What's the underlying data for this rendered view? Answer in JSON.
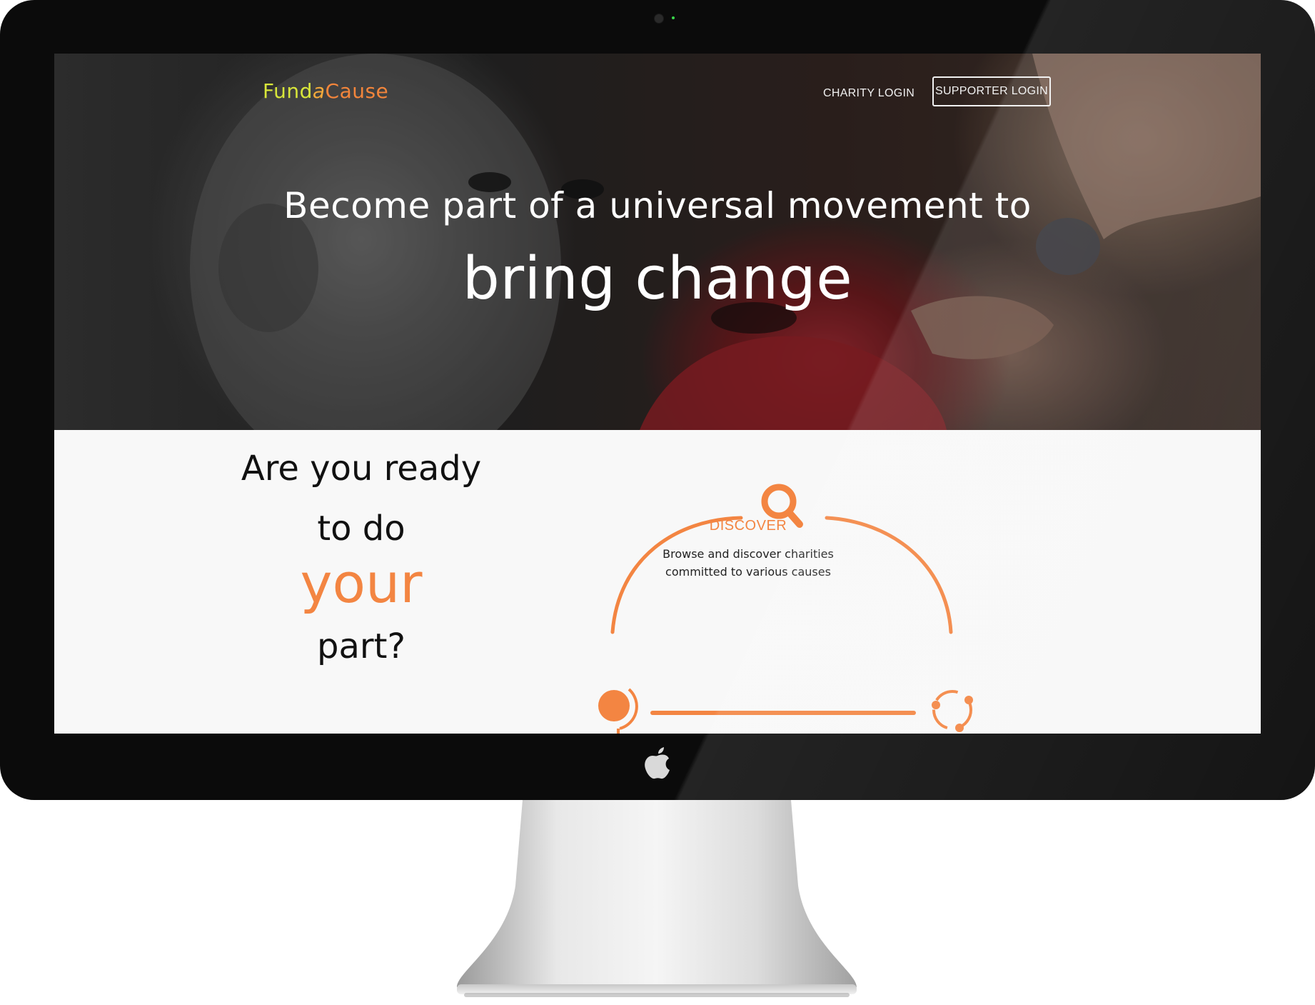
{
  "logo": {
    "part1": "Fund",
    "part2": "a",
    "part3": "Cause"
  },
  "nav": {
    "charity_login": "CHARITY LOGIN",
    "supporter_login": "SUPPORTER LOGIN"
  },
  "hero": {
    "line1": "Become part of a universal movement to",
    "line2": "bring change"
  },
  "ready": {
    "line1": "Are you ready",
    "line2": "to do",
    "line3": "your",
    "line4": "part?"
  },
  "process": {
    "discover_title": "DISCOVER",
    "discover_desc_line1": "Browse and discover charities",
    "discover_desc_line2": "committed to various causes"
  },
  "icons": [
    "search-icon",
    "globe-icon",
    "cycle-icon",
    "apple-logo-icon"
  ],
  "colors": {
    "accent": "#f38542",
    "logo_green": "#d8e63a",
    "monitor_bezel": "#0b0b0b"
  }
}
